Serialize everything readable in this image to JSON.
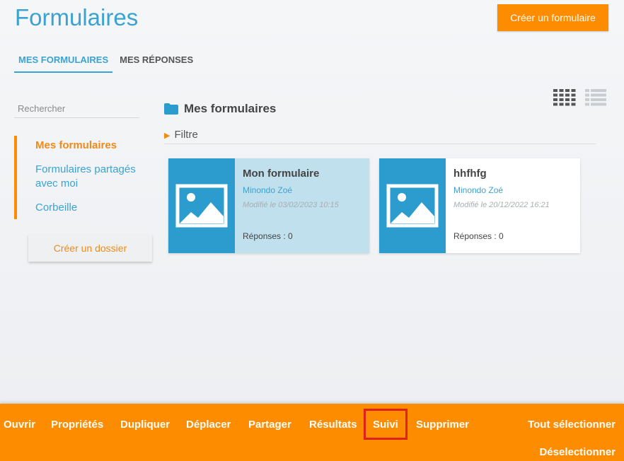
{
  "header": {
    "title": "Formulaires",
    "create_form_label": "Créer un formulaire"
  },
  "tabs": [
    {
      "label": "MES FORMULAIRES",
      "active": true
    },
    {
      "label": "MES RÉPONSES",
      "active": false
    }
  ],
  "search": {
    "placeholder": "Rechercher"
  },
  "sidebar": {
    "items": [
      {
        "label": "Mes formulaires",
        "active": true
      },
      {
        "label": "Formulaires partagés avec moi",
        "active": false
      },
      {
        "label": "Corbeille",
        "active": false
      }
    ],
    "create_folder_label": "Créer un dossier"
  },
  "main": {
    "folder_title": "Mes formulaires",
    "filter_label": "Filtre",
    "view_modes": [
      "grid-view-icon",
      "list-view-icon"
    ],
    "cards": [
      {
        "title": "Mon formulaire",
        "author": "Minondo Zoé",
        "modified": "Modifié le 03/02/2023 10:15",
        "responses": "Réponses : 0",
        "selected": true
      },
      {
        "title": "hhfhfg",
        "author": "Minondo Zoé",
        "modified": "Modifié le 20/12/2022 16:21",
        "responses": "Réponses : 0",
        "selected": false
      }
    ]
  },
  "action_bar": {
    "actions": [
      "Ouvrir",
      "Propriétés",
      "Dupliquer",
      "Déplacer",
      "Partager",
      "Résultats",
      "Suivi",
      "Supprimer"
    ],
    "highlighted": "Suivi",
    "select_all": "Tout sélectionner",
    "deselect": "Déselectionner"
  },
  "colors": {
    "accent_blue": "#3aa3d2",
    "accent_orange": "#fe8c00",
    "highlight_red": "#e0201a"
  }
}
